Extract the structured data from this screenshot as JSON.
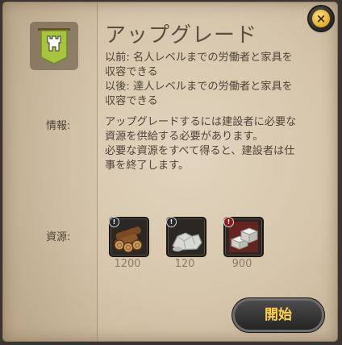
{
  "dialog": {
    "title": "アップグレード",
    "close_symbol": "×",
    "change_lines": [
      "以前: 名人レベルまでの労働者と家具を",
      "収容できる",
      "以後: 達人レベルまでの労働者と家具を",
      "収容できる"
    ],
    "info_label": "情報:",
    "info_lines": [
      "アップグレードするには建設者に必要な",
      "資源を供給する必要があります。",
      "必要な資源をすべて得ると、建設者は仕",
      "事を終了します。"
    ],
    "resources_label": "資源:",
    "resources": [
      {
        "icon": "wood-logs-icon",
        "amount": "1200"
      },
      {
        "icon": "stone-icon",
        "amount": "120"
      },
      {
        "icon": "stone-blocks-icon",
        "amount": "900"
      }
    ],
    "start_label": "開始"
  },
  "colors": {
    "parchment": "#d6c6ac",
    "text": "#4f4438",
    "title": "#5a4e40",
    "button_text": "#ffd347",
    "banner_green": "#9ab83a"
  },
  "icons": {
    "banner": "castle-banner-icon",
    "close": "close-icon"
  }
}
